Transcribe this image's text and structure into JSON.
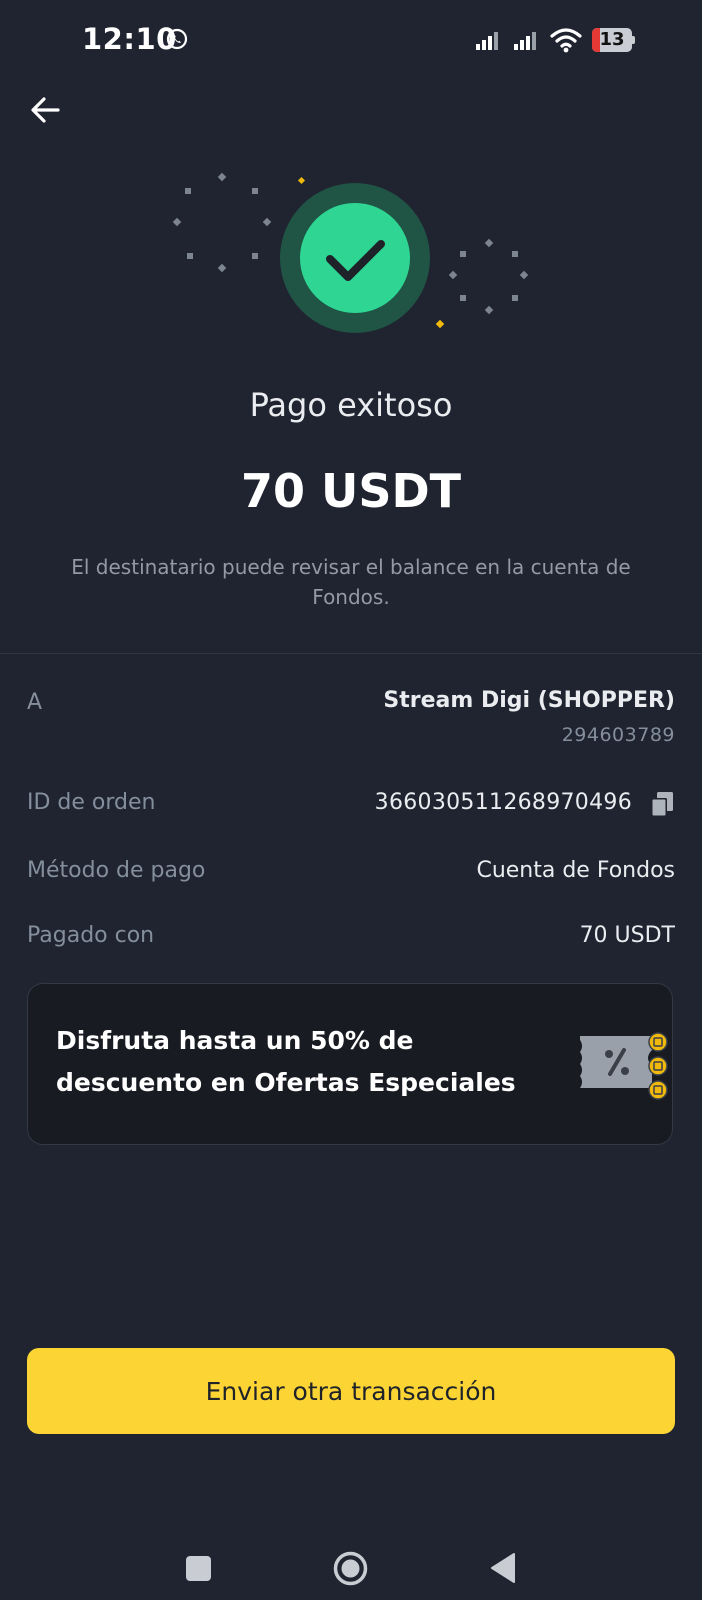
{
  "status_bar": {
    "time": "12:10",
    "battery_level": "13",
    "icons": [
      "whatsapp-icon",
      "signal-icon",
      "signal-icon",
      "wifi-icon",
      "battery-icon"
    ]
  },
  "header": {
    "back_icon": "arrow-left-icon"
  },
  "result": {
    "icon": "check-icon",
    "title": "Pago exitoso",
    "amount": "70 USDT",
    "note": "El destinatario puede revisar el balance en la cuenta de Fondos."
  },
  "details": {
    "recipient": {
      "label": "A",
      "name": "Stream Digi (SHOPPER)",
      "id": "294603789"
    },
    "order_id": {
      "label": "ID de orden",
      "value": "366030511268970496",
      "icon": "copy-icon"
    },
    "payment_method": {
      "label": "Método de pago",
      "value": "Cuenta de Fondos"
    },
    "paid_with": {
      "label": "Pagado con",
      "value": "70 USDT"
    }
  },
  "promo": {
    "text": "Disfruta hasta un 50% de descuento en Ofertas Especiales",
    "icon": "coupon-icon"
  },
  "action": {
    "label": "Enviar otra transacción"
  },
  "nav": {
    "icons": [
      "recents-square-icon",
      "home-circle-icon",
      "back-triangle-icon"
    ]
  },
  "colors": {
    "background": "#1f2430",
    "accent_yellow": "#fcd535",
    "success_green": "#2ed593",
    "muted_text": "#848e9c",
    "card_background": "#181b22"
  }
}
